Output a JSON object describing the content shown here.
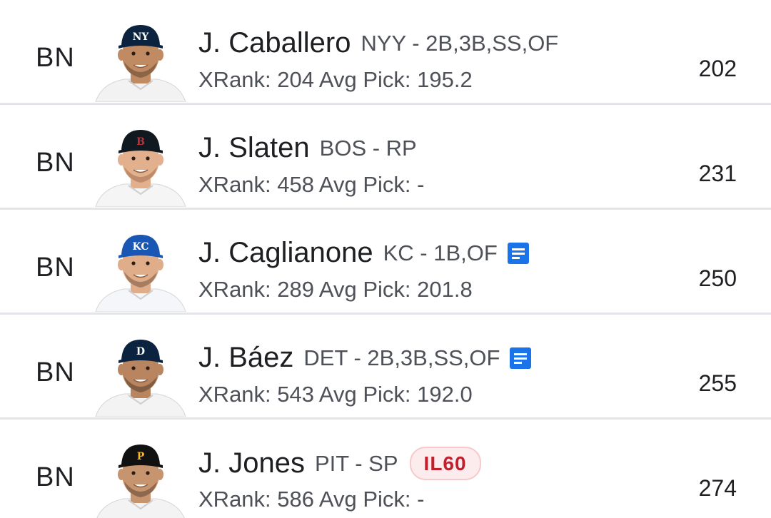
{
  "colors": {
    "text_primary": "#1d1f22",
    "text_secondary": "#4e5258",
    "note_icon": "#1a73e8",
    "il_badge_text": "#c21f2c",
    "il_badge_bg": "#fdeced",
    "divider": "#e3e5e8"
  },
  "players": [
    {
      "slot": "BN",
      "name": "J. Caballero",
      "team_pos": "NYY - 2B,3B,SS,OF",
      "stats": "XRank: 204 Avg Pick: 195.2",
      "value": "202",
      "has_note": false,
      "badge": "",
      "cap_color": "#0c2340",
      "cap_logo": "NY",
      "logo_color": "#ffffff",
      "jersey_color": "#f2f2f2",
      "skin_color": "#c08a62",
      "hair_color": "#2a1d15"
    },
    {
      "slot": "BN",
      "name": "J. Slaten",
      "team_pos": "BOS - RP",
      "stats": "XRank: 458 Avg Pick: -",
      "value": "231",
      "has_note": false,
      "badge": "",
      "cap_color": "#101820",
      "cap_logo": "B",
      "logo_color": "#bd3039",
      "jersey_color": "#f5f5f5",
      "skin_color": "#e2b08d",
      "hair_color": "#7a4a2a"
    },
    {
      "slot": "BN",
      "name": "J. Caglianone",
      "team_pos": "KC - 1B,OF",
      "stats": "XRank: 289 Avg Pick: 201.8",
      "value": "250",
      "has_note": true,
      "badge": "",
      "cap_color": "#1a56b4",
      "cap_logo": "KC",
      "logo_color": "#ffffff",
      "jersey_color": "#f4f6fa",
      "skin_color": "#e0ad8a",
      "hair_color": "#3a2618"
    },
    {
      "slot": "BN",
      "name": "J. Báez",
      "team_pos": "DET - 2B,3B,SS,OF",
      "stats": "XRank: 543 Avg Pick: 192.0",
      "value": "255",
      "has_note": true,
      "badge": "",
      "cap_color": "#0c2340",
      "cap_logo": "D",
      "logo_color": "#ffffff",
      "jersey_color": "#f3f3f3",
      "skin_color": "#b98560",
      "hair_color": "#1b140f"
    },
    {
      "slot": "BN",
      "name": "J. Jones",
      "team_pos": "PIT - SP",
      "stats": "XRank: 586 Avg Pick: -",
      "value": "274",
      "has_note": false,
      "badge": "IL60",
      "cap_color": "#111111",
      "cap_logo": "P",
      "logo_color": "#fdb827",
      "jersey_color": "#f3f3f3",
      "skin_color": "#c79470",
      "hair_color": "#22170f"
    }
  ]
}
